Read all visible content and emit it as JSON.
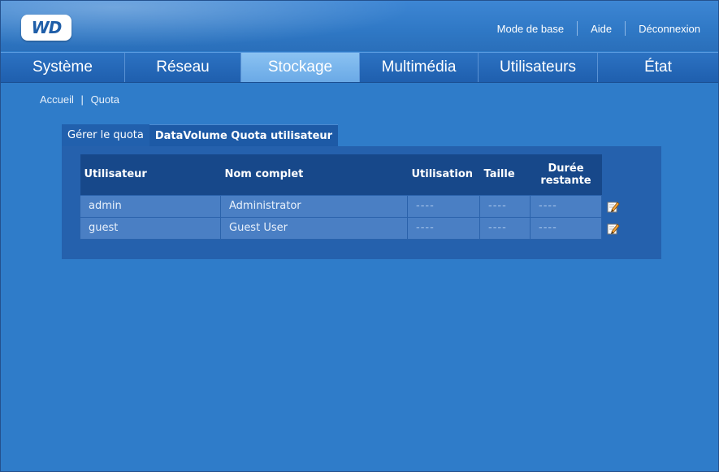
{
  "logo": {
    "text": "WD"
  },
  "header": {
    "links": {
      "basic_mode": "Mode de base",
      "help": "Aide",
      "logout": "Déconnexion"
    }
  },
  "nav": {
    "tabs": [
      {
        "label": "Système",
        "active": false
      },
      {
        "label": "Réseau",
        "active": false
      },
      {
        "label": "Stockage",
        "active": true
      },
      {
        "label": "Multimédia",
        "active": false
      },
      {
        "label": "Utilisateurs",
        "active": false
      },
      {
        "label": "État",
        "active": false
      }
    ]
  },
  "breadcrumb": {
    "home": "Accueil",
    "separator": "|",
    "current": "Quota"
  },
  "subtabs": [
    {
      "label": "Gérer le quota",
      "active": false
    },
    {
      "label": "DataVolume Quota utilisateur",
      "active": true
    }
  ],
  "quota_table": {
    "headers": {
      "user": "Utilisateur",
      "full_name": "Nom complet",
      "usage": "Utilisation",
      "size": "Taille",
      "remaining_line1": "Durée",
      "remaining_line2": "restante"
    },
    "rows": [
      {
        "user": "admin",
        "full_name": "Administrator",
        "usage": "----",
        "size": "----",
        "remaining": "----"
      },
      {
        "user": "guest",
        "full_name": "Guest User",
        "usage": "----",
        "size": "----",
        "remaining": "----"
      }
    ]
  },
  "colors": {
    "background": "#2f7cc9",
    "nav_active": "#7bb7ee",
    "table_header": "#17488a",
    "table_cell": "#4a7fc4"
  }
}
